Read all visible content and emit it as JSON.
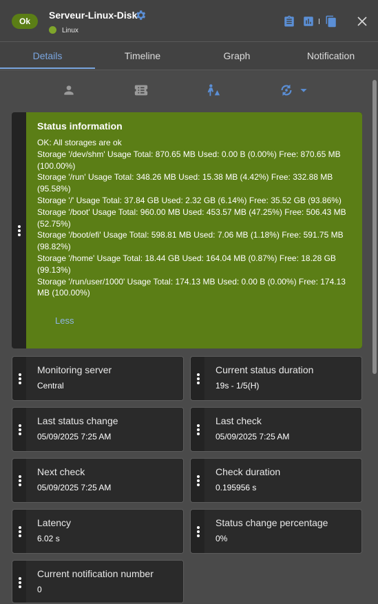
{
  "header": {
    "status_badge": "Ok",
    "title": "Serveur-Linux-Disk",
    "subtitle": "Linux",
    "status_color": "#5b7e16",
    "icons": [
      "clipboard-icon",
      "chart-icon",
      "copy-icon",
      "close-icon"
    ]
  },
  "tabs": [
    {
      "label": "Details",
      "active": true
    },
    {
      "label": "Timeline",
      "active": false
    },
    {
      "label": "Graph",
      "active": false
    },
    {
      "label": "Notification",
      "active": false
    }
  ],
  "toolbar": {
    "icons": [
      "user-icon",
      "ticket-icon",
      "acknowledge-icon",
      "refresh-dropdown-icon"
    ]
  },
  "status_panel": {
    "title": "Status information",
    "lines": [
      "OK: All storages are ok",
      "Storage '/dev/shm' Usage Total: 870.65 MB Used: 0.00 B (0.00%) Free: 870.65 MB (100.00%)",
      "Storage '/run' Usage Total: 348.26 MB Used: 15.38 MB (4.42%) Free: 332.88 MB (95.58%)",
      "Storage '/' Usage Total: 37.84 GB Used: 2.32 GB (6.14%) Free: 35.52 GB (93.86%)",
      "Storage '/boot' Usage Total: 960.00 MB Used: 453.57 MB (47.25%) Free: 506.43 MB (52.75%)",
      "Storage '/boot/efi' Usage Total: 598.81 MB Used: 7.06 MB (1.18%) Free: 591.75 MB (98.82%)",
      "Storage '/home' Usage Total: 18.44 GB Used: 164.04 MB (0.87%) Free: 18.28 GB (99.13%)",
      "Storage '/run/user/1000' Usage Total: 174.13 MB Used: 0.00 B (0.00%) Free: 174.13 MB (100.00%)"
    ],
    "less_label": "Less"
  },
  "cards": [
    {
      "label": "Monitoring server",
      "value": "Central"
    },
    {
      "label": "Current status duration",
      "value": "19s - 1/5(H)"
    },
    {
      "label": "Last status change",
      "value": "05/09/2025 7:25 AM"
    },
    {
      "label": "Last check",
      "value": "05/09/2025 7:25 AM"
    },
    {
      "label": "Next check",
      "value": "05/09/2025 7:25 AM"
    },
    {
      "label": "Check duration",
      "value": "0.195956 s"
    },
    {
      "label": "Latency",
      "value": "6.02 s"
    },
    {
      "label": "Status change percentage",
      "value": "0%"
    },
    {
      "label": "Current notification number",
      "value": "0"
    }
  ]
}
